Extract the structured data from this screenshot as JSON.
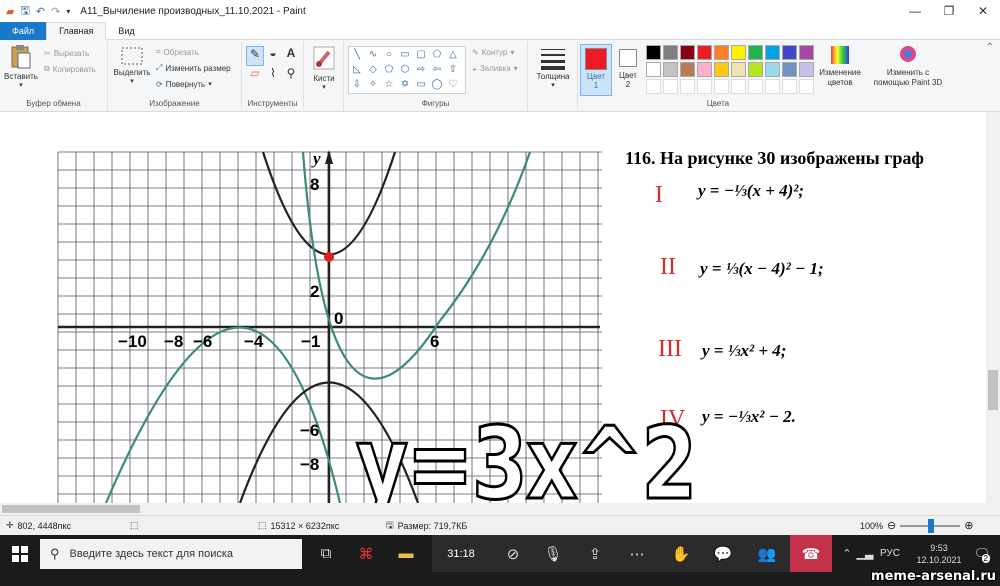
{
  "window": {
    "title": "А11_Вычиление производных_11.10.2021 - Paint",
    "quick_access_icons": [
      "paint-app-icon",
      "save-icon",
      "undo-icon",
      "redo-icon",
      "customize-dropdown-icon"
    ],
    "controls": [
      "minimize",
      "maximize",
      "close"
    ]
  },
  "tabs": [
    {
      "label": "Файл"
    },
    {
      "label": "Главная"
    },
    {
      "label": "Вид"
    }
  ],
  "ribbon": {
    "clipboard": {
      "paste": "Вставить",
      "cut": "Вырезать",
      "copy": "Копировать",
      "group": "Буфер обмена"
    },
    "image": {
      "select": "Выделить",
      "crop": "Обрезать",
      "resize": "Изменить размер",
      "rotate": "Повернуть",
      "group": "Изображение"
    },
    "tools": {
      "group": "Инструменты"
    },
    "brushes": {
      "label": "Кисти"
    },
    "shapes": {
      "outline": "Контур",
      "fill": "Заливка",
      "group": "Фигуры"
    },
    "size": {
      "label": "Толщина"
    },
    "colors": {
      "color1": "Цвет 1",
      "color2": "Цвет 2",
      "edit": "Изменение цветов",
      "paint3d": "Изменить с помощью Paint 3D",
      "group": "Цвета",
      "color1_value": "#ed1c24",
      "color2_value": "#ffffff",
      "palette_row1": [
        "#000000",
        "#7f7f7f",
        "#880015",
        "#ed1c24",
        "#ff7f27",
        "#fff200",
        "#22b14c",
        "#00a2e8",
        "#3f48cc",
        "#a349a4"
      ],
      "palette_row2": [
        "#ffffff",
        "#c3c3c3",
        "#b97a57",
        "#ffaec9",
        "#ffc90e",
        "#efe4b0",
        "#b5e61d",
        "#99d9ea",
        "#7092be",
        "#c8bfe7"
      ]
    }
  },
  "canvas": {
    "problem_heading": "116. На рисунке 30 изображены граф",
    "equations": [
      {
        "roman": "I",
        "formula": "y = −⅓(x + 4)²;"
      },
      {
        "roman": "II",
        "formula": "y = ⅓(x − 4)² − 1;"
      },
      {
        "roman": "III",
        "formula": "y = ⅓x² + 4;"
      },
      {
        "roman": "IV",
        "formula": "y = −⅓x² − 2."
      }
    ],
    "graph": {
      "y_axis_label": "y",
      "y_ticks": [
        "8",
        "2",
        "−6",
        "−8"
      ],
      "x_ticks": [
        "−10",
        "−8",
        "−6",
        "−4",
        "−1",
        "6"
      ],
      "origin": "0"
    },
    "overlay_text": "y=3x^2"
  },
  "status": {
    "cursor_pos": "802, 4448пкс",
    "image_size": "15312 × 6232пкс",
    "file_size": "Размер: 719,7КБ",
    "zoom": "100%"
  },
  "taskbar": {
    "search_placeholder": "Введите здесь текст для поиска",
    "meeting_timer": "31:18",
    "language": "РУС",
    "time": "9:53",
    "date": "12.10.2021",
    "notifications": "2"
  },
  "watermark": "meme-arsenal.ru"
}
